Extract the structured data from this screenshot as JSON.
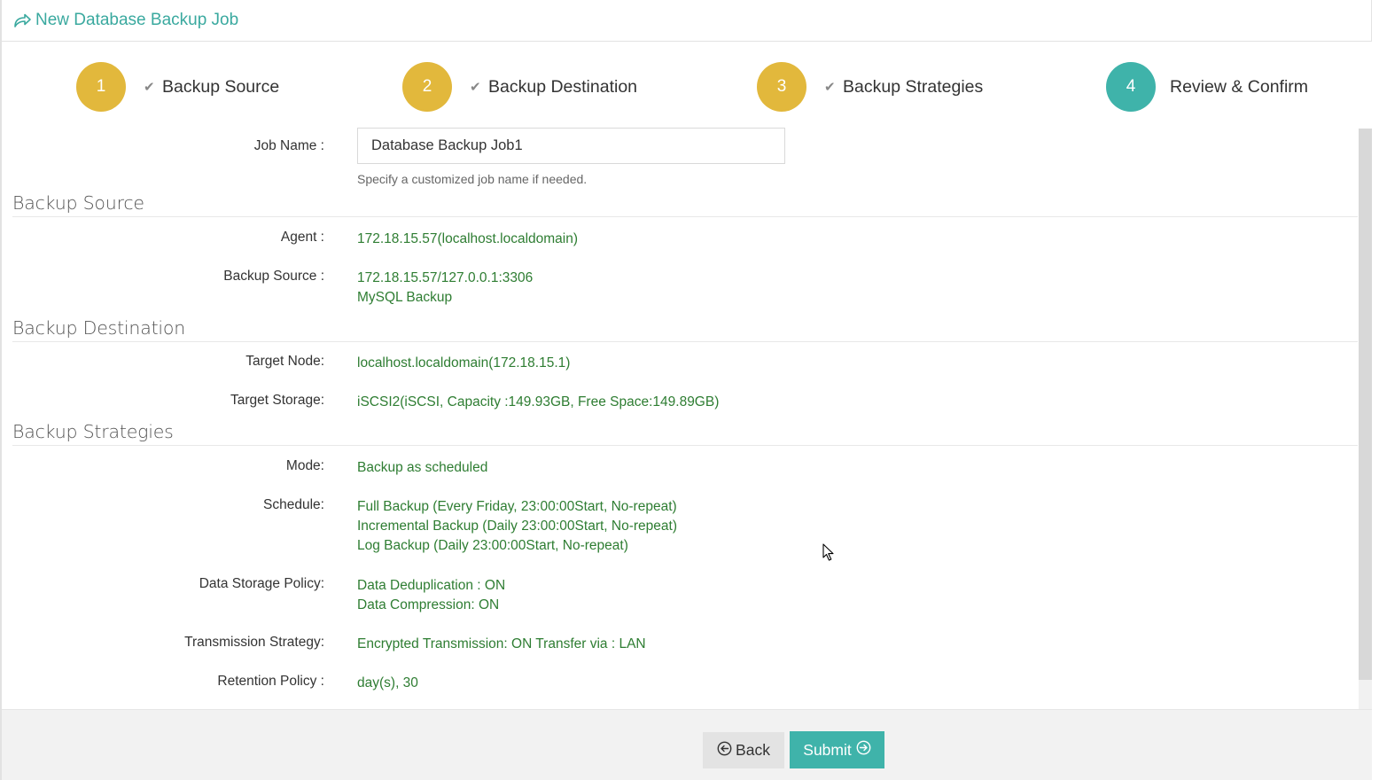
{
  "header": {
    "title": "New Database Backup Job",
    "icon": "share-arrow-icon"
  },
  "steps": [
    {
      "number": "1",
      "label": "Backup Source",
      "state": "done"
    },
    {
      "number": "2",
      "label": "Backup Destination",
      "state": "done"
    },
    {
      "number": "3",
      "label": "Backup Strategies",
      "state": "done"
    },
    {
      "number": "4",
      "label": "Review & Confirm",
      "state": "active"
    }
  ],
  "job_name": {
    "label": "Job Name :",
    "value": "Database Backup Job1",
    "hint": "Specify a customized job name if needed."
  },
  "sections": {
    "source": {
      "title": "Backup Source",
      "agent_label": "Agent :",
      "agent_value": "172.18.15.57(localhost.localdomain)",
      "source_label": "Backup Source :",
      "source_lines": [
        "172.18.15.57/127.0.0.1:3306",
        "MySQL Backup"
      ]
    },
    "destination": {
      "title": "Backup Destination",
      "node_label": "Target Node:",
      "node_value": "localhost.localdomain(172.18.15.1)",
      "storage_label": "Target Storage:",
      "storage_value": "iSCSI2(iSCSI, Capacity :149.93GB, Free Space:149.89GB)"
    },
    "strategies": {
      "title": "Backup Strategies",
      "mode_label": "Mode:",
      "mode_value": "Backup as scheduled",
      "schedule_label": "Schedule:",
      "schedule_lines": [
        "Full Backup (Every Friday, 23:00:00Start, No-repeat)",
        "Incremental Backup (Daily 23:00:00Start, No-repeat)",
        "Log Backup (Daily 23:00:00Start, No-repeat)"
      ],
      "storage_policy_label": "Data Storage Policy:",
      "storage_policy_lines": [
        "Data Deduplication : ON",
        "Data Compression: ON"
      ],
      "transmission_label": "Transmission Strategy:",
      "transmission_value": "Encrypted Transmission: ON Transfer via : LAN",
      "retention_label": "Retention Policy :",
      "retention_value": "day(s), 30"
    }
  },
  "footer": {
    "back_label": "Back",
    "submit_label": "Submit"
  },
  "colors": {
    "accent": "#3fb3aa",
    "step_done": "#e2b83c",
    "value_text": "#2e7d32"
  }
}
